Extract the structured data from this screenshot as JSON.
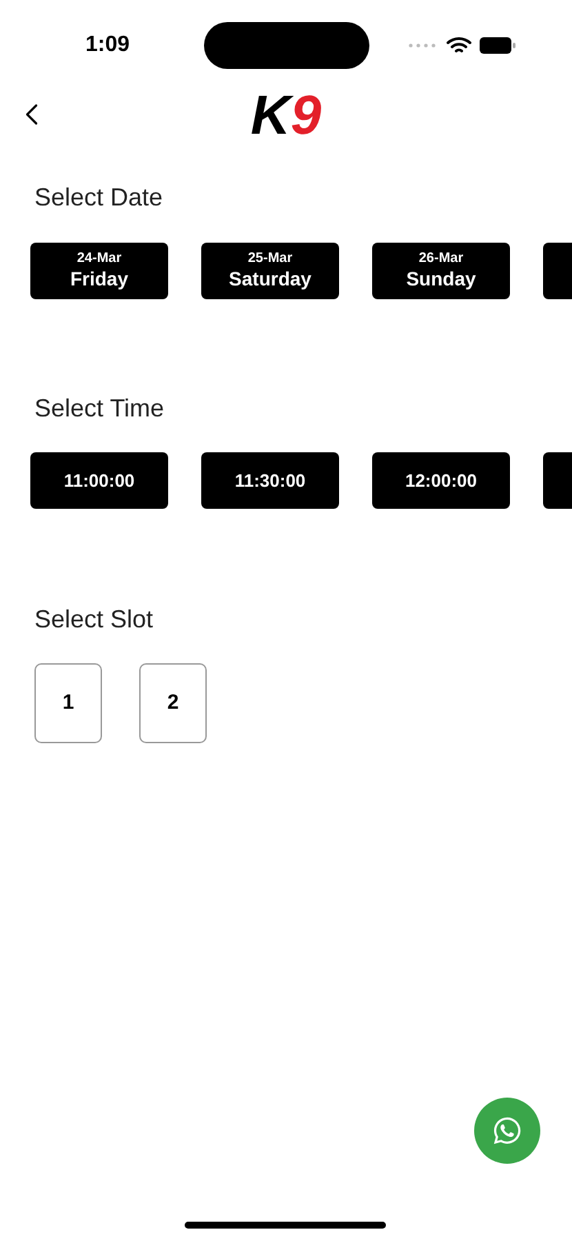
{
  "status_bar": {
    "time": "1:09"
  },
  "header": {
    "logo": [
      "K",
      "9"
    ]
  },
  "date_section": {
    "title": "Select Date",
    "dates": [
      {
        "date": "24-Mar",
        "day": "Friday"
      },
      {
        "date": "25-Mar",
        "day": "Saturday"
      },
      {
        "date": "26-Mar",
        "day": "Sunday"
      }
    ]
  },
  "time_section": {
    "title": "Select Time",
    "times": [
      "11:00:00",
      "11:30:00",
      "12:00:00"
    ]
  },
  "slot_section": {
    "title": "Select Slot",
    "slots": [
      "1",
      "2"
    ]
  }
}
